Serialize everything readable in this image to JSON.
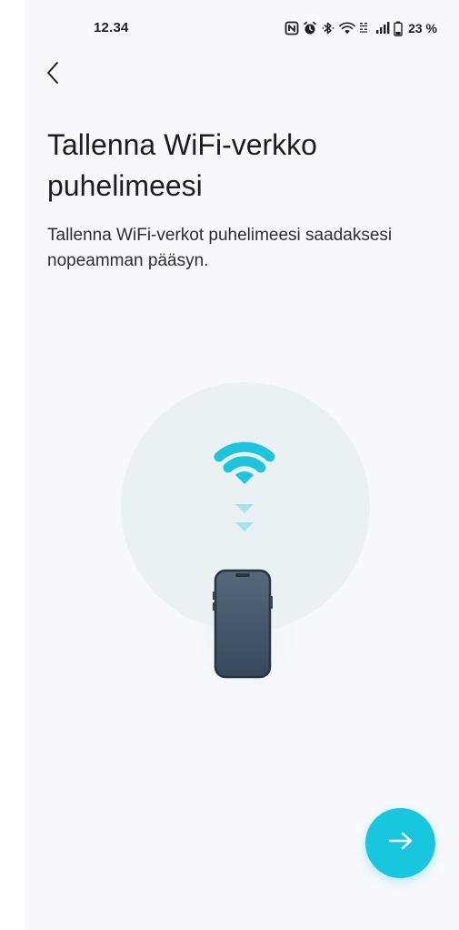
{
  "status_bar": {
    "time": "12.34",
    "battery_percent": "23 %",
    "icons": [
      "nfc-icon",
      "alarm-icon",
      "bluetooth-icon",
      "wifi-icon",
      "volte-icon",
      "signal-icon",
      "battery-icon"
    ]
  },
  "navigation": {
    "back_icon": "chevron-left-icon"
  },
  "content": {
    "title": "Tallenna WiFi-verkko puhelimeesi",
    "subtitle": "Tallenna WiFi-verkot puhelimeesi saadaksesi nopeamman pääsyn."
  },
  "illustration": {
    "icons": [
      "wifi-icon",
      "arrow-down-icon",
      "phone-icon"
    ]
  },
  "next_button": {
    "icon": "arrow-right-icon"
  },
  "colors": {
    "accent": "#18c6de",
    "background": "#f6f8fb",
    "text_primary": "#1b1d21",
    "phone_body": "#3c4f5d"
  }
}
